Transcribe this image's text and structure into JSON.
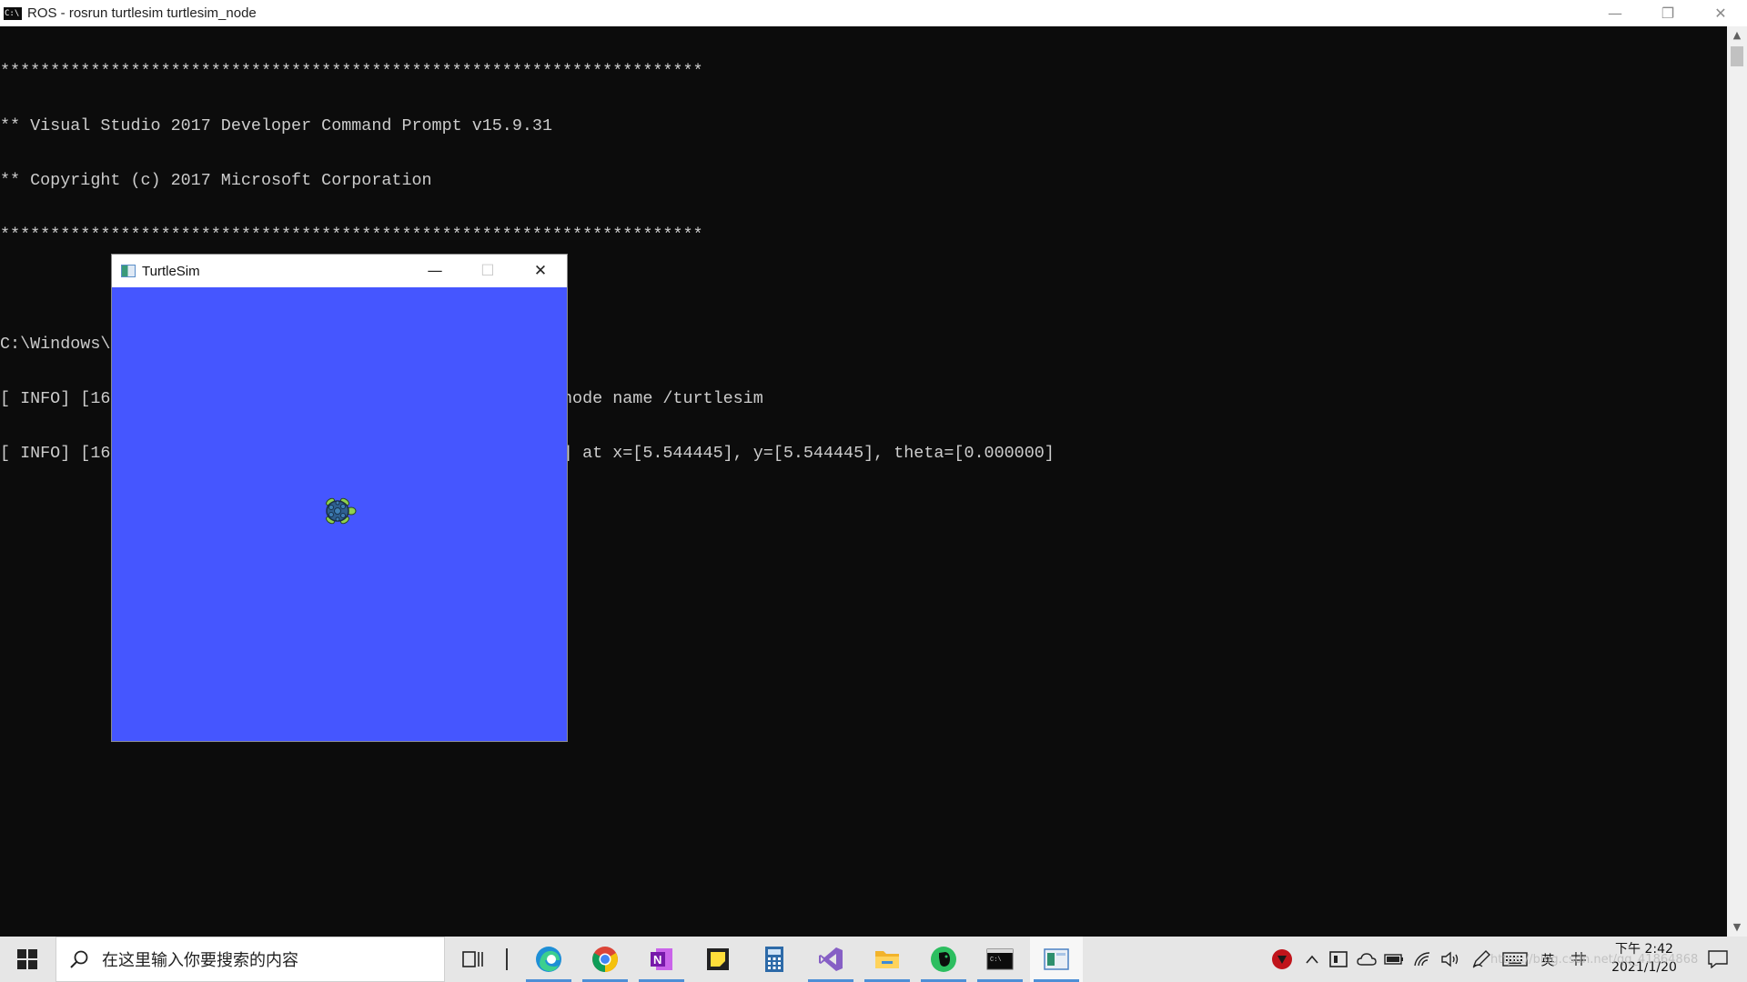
{
  "console_window": {
    "title": "ROS - rosrun  turtlesim turtlesim_node",
    "icon": "C:\\",
    "minimize_glyph": "—",
    "restore_glyph": "❐",
    "close_glyph": "✕",
    "lines": [
      "**********************************************************************",
      "** Visual Studio 2017 Developer Command Prompt v15.9.31",
      "** Copyright (c) 2017 Microsoft Corporation",
      "**********************************************************************",
      "",
      "C:\\Windows\\System32>rosrun turtlesim turtlesim_node",
      "[ INFO] [1611124883.627681700]: Starting turtlesim with node name /turtlesim",
      "[ INFO] [1611124883.633383000]: Spawning turtle [turtle1] at x=[5.544445], y=[5.544445], theta=[0.000000]"
    ]
  },
  "turtlesim_window": {
    "title": "TurtleSim",
    "minimize_glyph": "—",
    "maximize_glyph": "☐",
    "close_glyph": "✕",
    "background_color": "#4556ff"
  },
  "taskbar": {
    "search_placeholder": "在这里输入你要搜索的内容",
    "apps": [
      {
        "name": "task-view",
        "icon": "task-view-icon"
      },
      {
        "name": "edge",
        "icon": "edge-icon"
      },
      {
        "name": "chrome",
        "icon": "chrome-icon"
      },
      {
        "name": "onenote",
        "icon": "onenote-icon"
      },
      {
        "name": "sticky-notes",
        "icon": "sticky-notes-icon"
      },
      {
        "name": "calculator",
        "icon": "calculator-icon"
      },
      {
        "name": "visual-studio",
        "icon": "visual-studio-icon"
      },
      {
        "name": "file-explorer",
        "icon": "folder-icon"
      },
      {
        "name": "evernote",
        "icon": "evernote-icon"
      },
      {
        "name": "command-prompt",
        "icon": "terminal-icon"
      },
      {
        "name": "turtlesim",
        "icon": "turtlesim-icon"
      }
    ],
    "tray": {
      "ime_label": "英",
      "time": "下午 2:42",
      "date": "2021/1/20"
    },
    "watermark": "https://blog.csdn.net/qq_41864868"
  }
}
